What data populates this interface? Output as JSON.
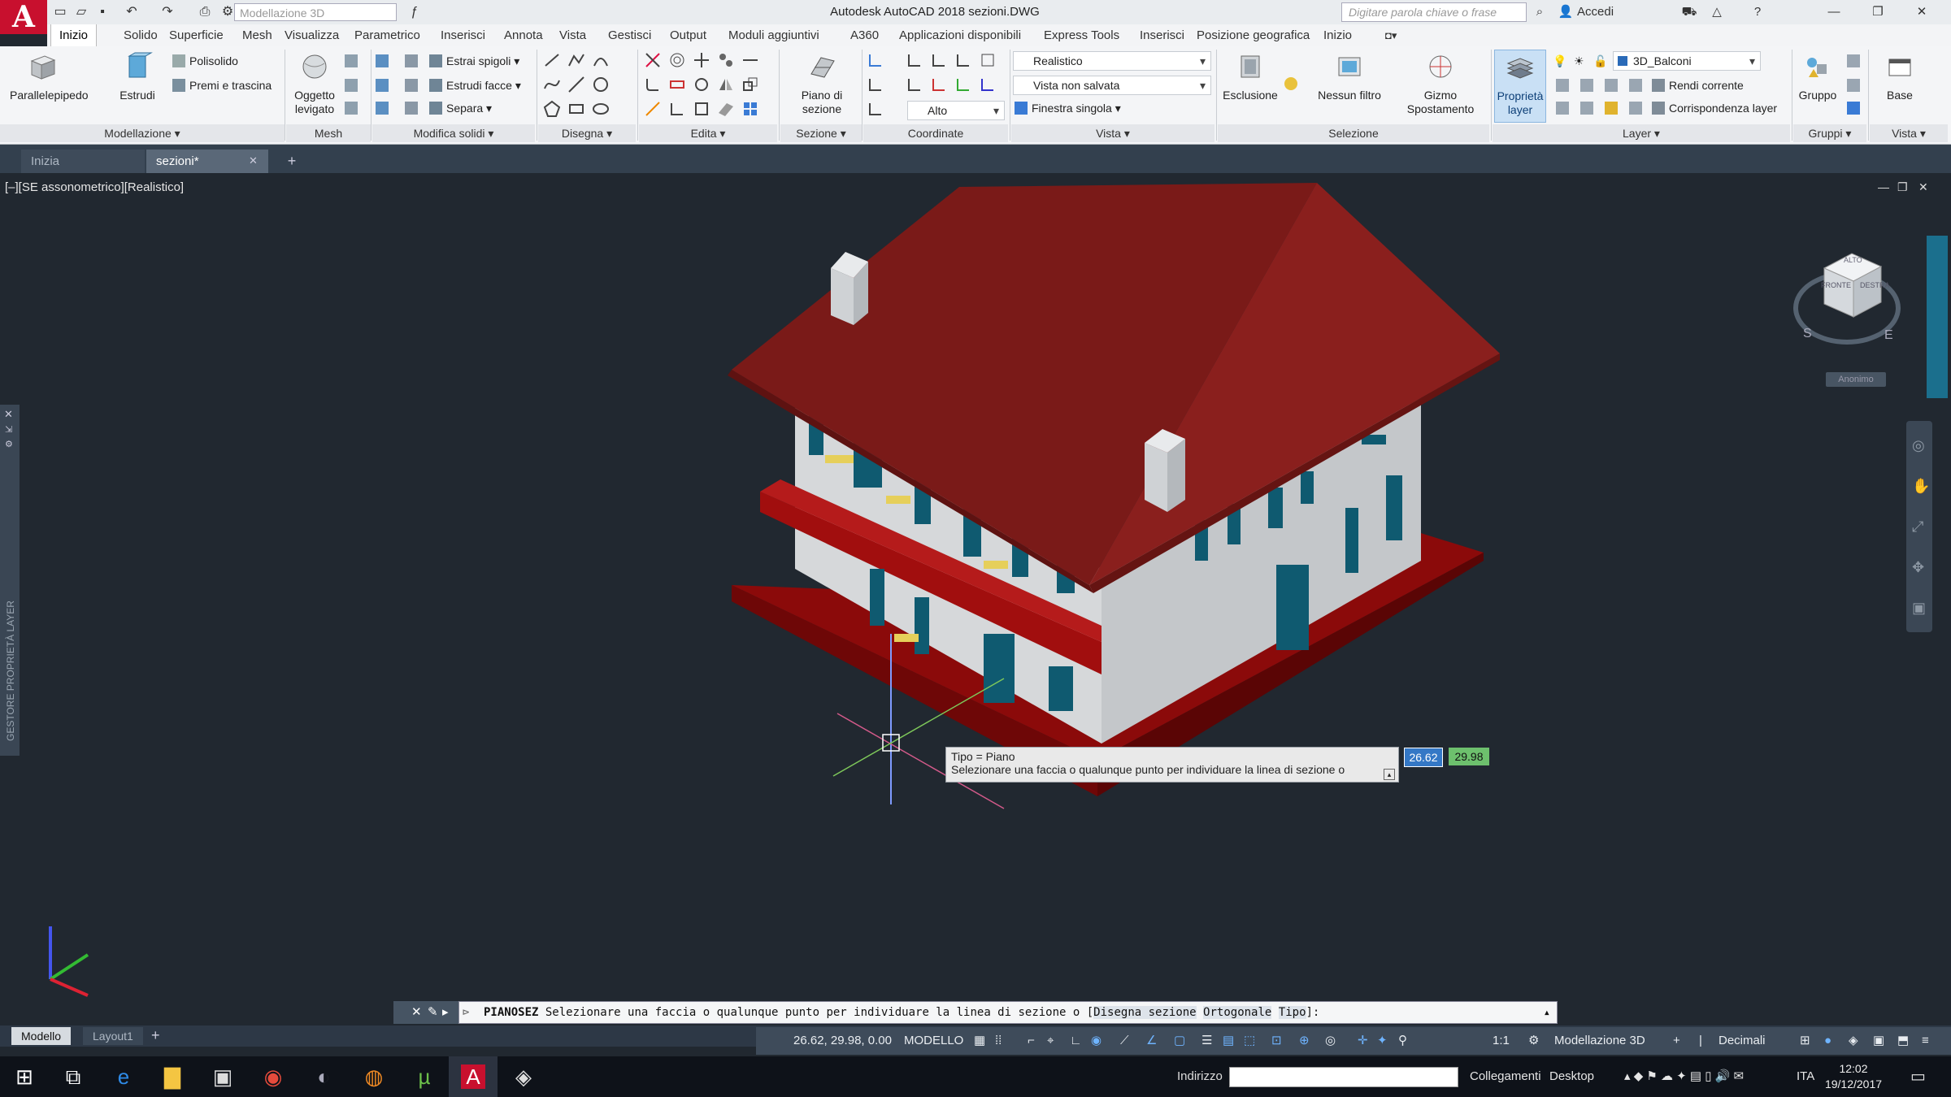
{
  "title_bar": {
    "app_logo": "A",
    "workspace": "Modellazione 3D",
    "document_title": "Autodesk AutoCAD 2018    sezioni.DWG",
    "search_placeholder": "Digitare parola chiave o frase",
    "sign_in": "Accedi"
  },
  "ribbon_tabs": [
    "Inizio",
    "Solido",
    "Superficie",
    "Mesh",
    "Visualizza",
    "Parametrico",
    "Inserisci",
    "Annota",
    "Vista",
    "Gestisci",
    "Output",
    "Moduli aggiuntivi",
    "A360",
    "Applicazioni disponibili",
    "Express Tools",
    "Inserisci",
    "Posizione geografica",
    "Inizio"
  ],
  "ribbon": {
    "modellazione": {
      "title": "Modellazione",
      "parallelepipedo": "Parallelepipedo",
      "estrudi": "Estrudi",
      "polisolido": "Polisolido",
      "premi_trascina": "Premi e trascina"
    },
    "mesh": {
      "title": "Mesh",
      "oggetto_levigato": "Oggetto levigato"
    },
    "modifica_solidi": {
      "title": "Modifica solidi",
      "estrai_spigoli": "Estrai spigoli",
      "estrudi_facce": "Estrudi facce",
      "separa": "Separa"
    },
    "disegna": {
      "title": "Disegna"
    },
    "edita": {
      "title": "Edita"
    },
    "sezione": {
      "title": "Sezione",
      "piano_sezione": "Piano di sezione"
    },
    "coordinate": {
      "title": "Coordinate",
      "alto": "Alto"
    },
    "vista": {
      "title": "Vista",
      "visual_style": "Realistico",
      "named_view": "Vista non salvata",
      "viewport": "Finestra singola"
    },
    "selezione": {
      "title": "Selezione",
      "esclusione": "Esclusione",
      "nessun_filtro": "Nessun filtro",
      "gizmo": "Gizmo Spostamento"
    },
    "layer": {
      "title": "Layer",
      "proprieta_layer": "Proprietà layer",
      "current_layer": "3D_Balconi",
      "rendi_corrente": "Rendi corrente",
      "corrispondenza": "Corrispondenza layer"
    },
    "gruppi": {
      "title": "Gruppi",
      "gruppo": "Gruppo"
    },
    "vista2": {
      "title": "Vista",
      "base": "Base"
    }
  },
  "doc_tabs": [
    "Inizia",
    "sezioni*"
  ],
  "viewport_label": "[–][SE assonometrico][Realistico]",
  "viewcube": {
    "top_label": "ALTO",
    "front": "FRONTE",
    "right": "DESTRA",
    "compass_s": "S",
    "compass_e": "E",
    "ucs_label": "Anonimo"
  },
  "side_palette_label": "GESTORE PROPRIETÀ LAYER",
  "tooltip": {
    "line1": "Tipo = Piano",
    "line2": "Selezionare una faccia o qualunque punto per individuare la linea di sezione o"
  },
  "dynamic_input": {
    "x": "26.62",
    "y": "29.98"
  },
  "command_line": {
    "command": "PIANOSEZ",
    "prompt": "Selezionare una faccia o qualunque punto per individuare la linea di sezione o [",
    "opt1": "Disegna sezione",
    "opt2": "Ortogonale",
    "opt3": "Tipo",
    "end": "]:"
  },
  "layout_tabs": [
    "Modello",
    "Layout1"
  ],
  "status_bar": {
    "coords": "26.62, 29.98, 0.00",
    "space": "MODELLO",
    "scale": "1:1",
    "workspace": "Modellazione 3D",
    "units": "Decimali"
  },
  "taskbar": {
    "address_label": "Indirizzo",
    "links": "Collegamenti",
    "desktop": "Desktop",
    "lang": "ITA",
    "time": "12:02",
    "date": "19/12/2017"
  },
  "colors": {
    "roof": "#8a1f1d",
    "walls": "#cfd2d5",
    "shutters": "#0f5a70",
    "base": "#8b0a0a",
    "canvas": "#212830"
  }
}
